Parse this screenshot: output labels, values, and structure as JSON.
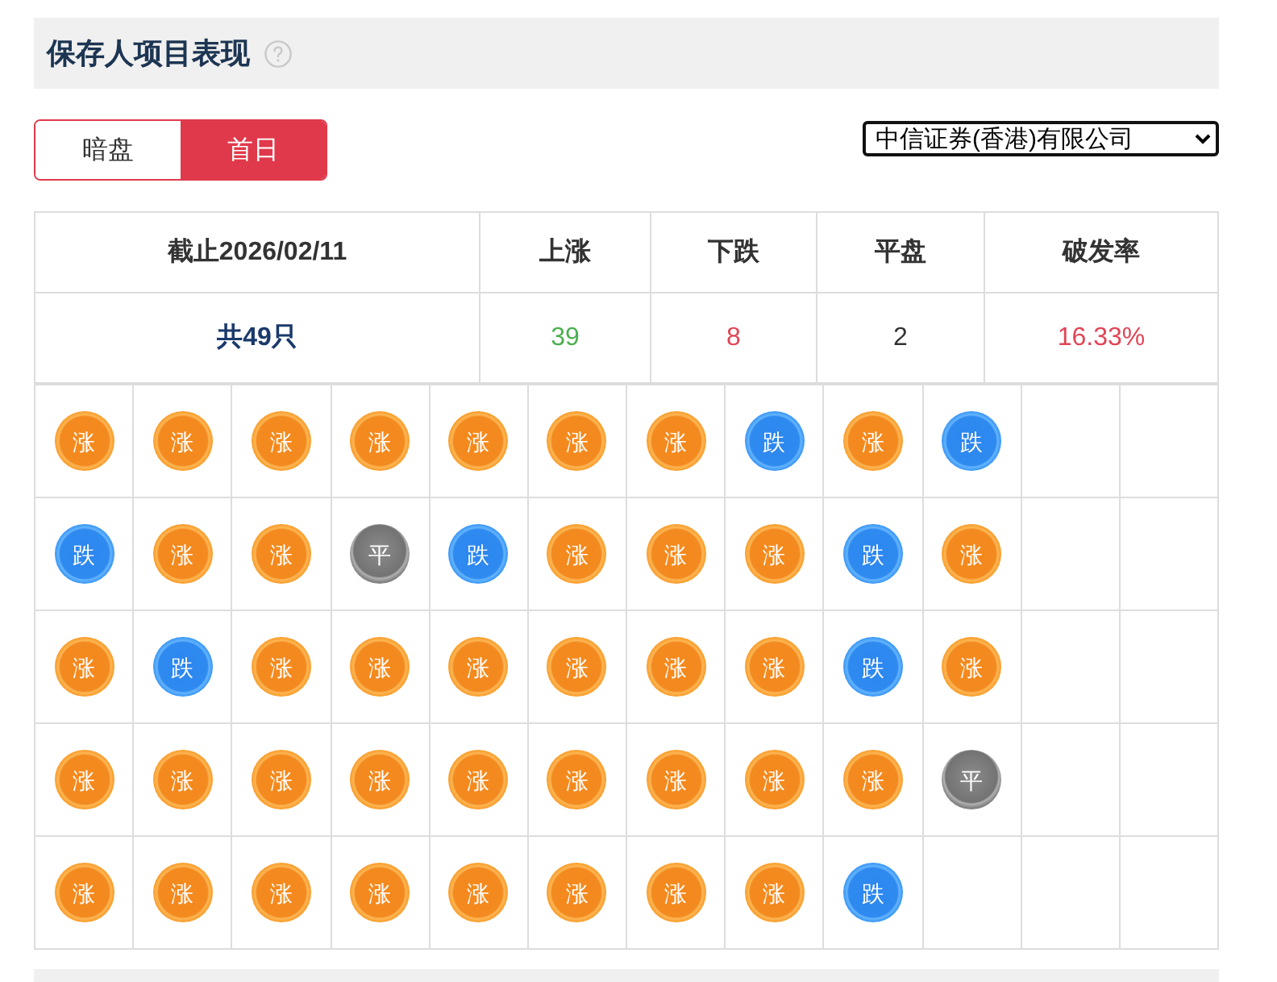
{
  "header": {
    "title": "保存人项目表现"
  },
  "tabs": [
    {
      "label": "暗盘",
      "selected": false
    },
    {
      "label": "首日",
      "selected": true
    }
  ],
  "broker_select": {
    "value": "中信证券(香港)有限公司"
  },
  "summary": {
    "columns": [
      "截止2026/02/11",
      "上涨",
      "下跌",
      "平盘",
      "破发率"
    ],
    "values": [
      {
        "kind": "total",
        "text": "共49只"
      },
      {
        "kind": "rise",
        "text": "39"
      },
      {
        "kind": "fall",
        "text": "8"
      },
      {
        "kind": "flat",
        "text": "2"
      },
      {
        "kind": "rate",
        "text": "16.33%"
      }
    ]
  },
  "results": {
    "rows": [
      [
        {
          "kind": "rise",
          "label": "涨"
        },
        {
          "kind": "rise",
          "label": "涨"
        },
        {
          "kind": "rise",
          "label": "涨"
        },
        {
          "kind": "rise",
          "label": "涨"
        },
        {
          "kind": "rise",
          "label": "涨"
        },
        {
          "kind": "rise",
          "label": "涨"
        },
        {
          "kind": "rise",
          "label": "涨"
        },
        {
          "kind": "fall",
          "label": "跌"
        },
        {
          "kind": "rise",
          "label": "涨"
        },
        {
          "kind": "fall",
          "label": "跌"
        }
      ],
      [
        {
          "kind": "fall",
          "label": "跌"
        },
        {
          "kind": "rise",
          "label": "涨"
        },
        {
          "kind": "rise",
          "label": "涨"
        },
        {
          "kind": "flat",
          "label": "平"
        },
        {
          "kind": "fall",
          "label": "跌"
        },
        {
          "kind": "rise",
          "label": "涨"
        },
        {
          "kind": "rise",
          "label": "涨"
        },
        {
          "kind": "rise",
          "label": "涨"
        },
        {
          "kind": "fall",
          "label": "跌"
        },
        {
          "kind": "rise",
          "label": "涨"
        }
      ],
      [
        {
          "kind": "rise",
          "label": "涨"
        },
        {
          "kind": "fall",
          "label": "跌"
        },
        {
          "kind": "rise",
          "label": "涨"
        },
        {
          "kind": "rise",
          "label": "涨"
        },
        {
          "kind": "rise",
          "label": "涨"
        },
        {
          "kind": "rise",
          "label": "涨"
        },
        {
          "kind": "rise",
          "label": "涨"
        },
        {
          "kind": "rise",
          "label": "涨"
        },
        {
          "kind": "fall",
          "label": "跌"
        },
        {
          "kind": "rise",
          "label": "涨"
        }
      ],
      [
        {
          "kind": "rise",
          "label": "涨"
        },
        {
          "kind": "rise",
          "label": "涨"
        },
        {
          "kind": "rise",
          "label": "涨"
        },
        {
          "kind": "rise",
          "label": "涨"
        },
        {
          "kind": "rise",
          "label": "涨"
        },
        {
          "kind": "rise",
          "label": "涨"
        },
        {
          "kind": "rise",
          "label": "涨"
        },
        {
          "kind": "rise",
          "label": "涨"
        },
        {
          "kind": "rise",
          "label": "涨"
        },
        {
          "kind": "flat",
          "label": "平"
        }
      ],
      [
        {
          "kind": "rise",
          "label": "涨"
        },
        {
          "kind": "rise",
          "label": "涨"
        },
        {
          "kind": "rise",
          "label": "涨"
        },
        {
          "kind": "rise",
          "label": "涨"
        },
        {
          "kind": "rise",
          "label": "涨"
        },
        {
          "kind": "rise",
          "label": "涨"
        },
        {
          "kind": "rise",
          "label": "涨"
        },
        {
          "kind": "rise",
          "label": "涨"
        },
        {
          "kind": "fall",
          "label": "跌"
        }
      ]
    ]
  }
}
